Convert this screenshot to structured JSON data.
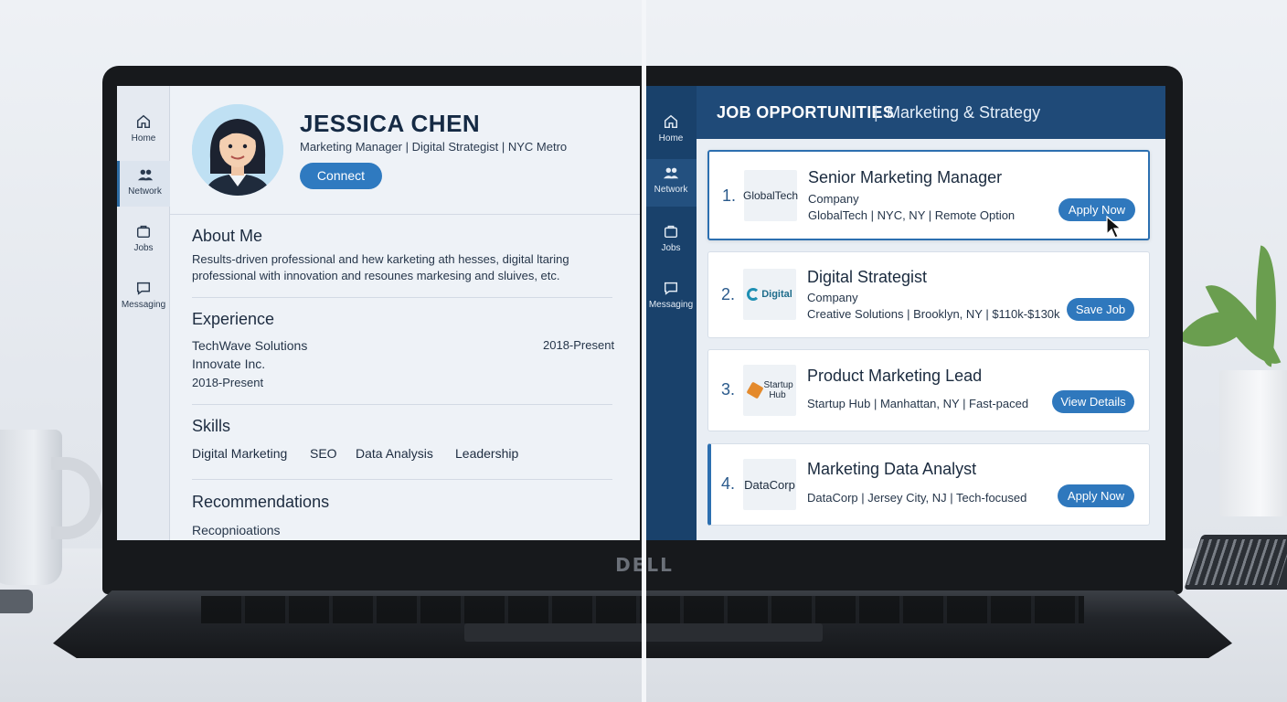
{
  "laptop": {
    "brand": "DELL"
  },
  "profile": {
    "nav": [
      {
        "label": "Home",
        "icon": "home-icon"
      },
      {
        "label": "Network",
        "icon": "network-icon"
      },
      {
        "label": "Jobs",
        "icon": "jobs-icon"
      },
      {
        "label": "Messaging",
        "icon": "messaging-icon"
      }
    ],
    "name": "JESSICA CHEN",
    "headline": "Marketing Manager | Digital Strategist | NYC Metro",
    "connect_label": "Connect",
    "about": {
      "title": "About Me",
      "text": "Results-driven professional and hew karketing ath hesses, digital ltaring professional with innovation and resounes markesing and sluives, etc."
    },
    "experience": {
      "title": "Experience",
      "company1": "TechWave Solutions",
      "company1_dates": "2018-Present",
      "company2": "Innovate Inc.",
      "company2_dates": "2018-Present"
    },
    "skills": {
      "title": "Skills",
      "items": [
        "Digital Marketing",
        "SEO",
        "Data Analysis",
        "Leadership"
      ]
    },
    "recommendations": {
      "title": "Recommendations",
      "preview": "Recopnioations"
    }
  },
  "jobs": {
    "nav": [
      {
        "label": "Home",
        "icon": "home-icon"
      },
      {
        "label": "Network",
        "icon": "network-icon"
      },
      {
        "label": "Jobs",
        "icon": "jobs-icon"
      },
      {
        "label": "Messaging",
        "icon": "messaging-icon"
      }
    ],
    "header_title": "JOB OPPORTUNITIES",
    "header_separator": "|",
    "header_subtitle": "Marketing & Strategy",
    "listings": [
      {
        "num": "1.",
        "logo": "GlobalTech",
        "title": "Senior Marketing Manager",
        "type": "Company",
        "details": "GlobalTech | NYC, NY | Remote Option",
        "action": "Apply Now"
      },
      {
        "num": "2.",
        "logo": "Digital",
        "title": "Digital Strategist",
        "type": "Company",
        "details": "Creative Solutions | Brooklyn, NY | $110k-$130k",
        "action": "Save Job"
      },
      {
        "num": "3.",
        "logo": "Startup Hub",
        "title": "Product Marketing Lead",
        "details": "Startup Hub | Manhattan, NY | Fast-paced",
        "action": "View Details"
      },
      {
        "num": "4.",
        "logo": "DataCorp",
        "title": "Marketing Data Analyst",
        "details": "DataCorp | Jersey City, NJ | Tech-focused",
        "action": "Apply Now"
      }
    ]
  },
  "colors": {
    "accent": "#2f78bd",
    "header": "#1f4a78",
    "nav_dark": "#19416b"
  }
}
